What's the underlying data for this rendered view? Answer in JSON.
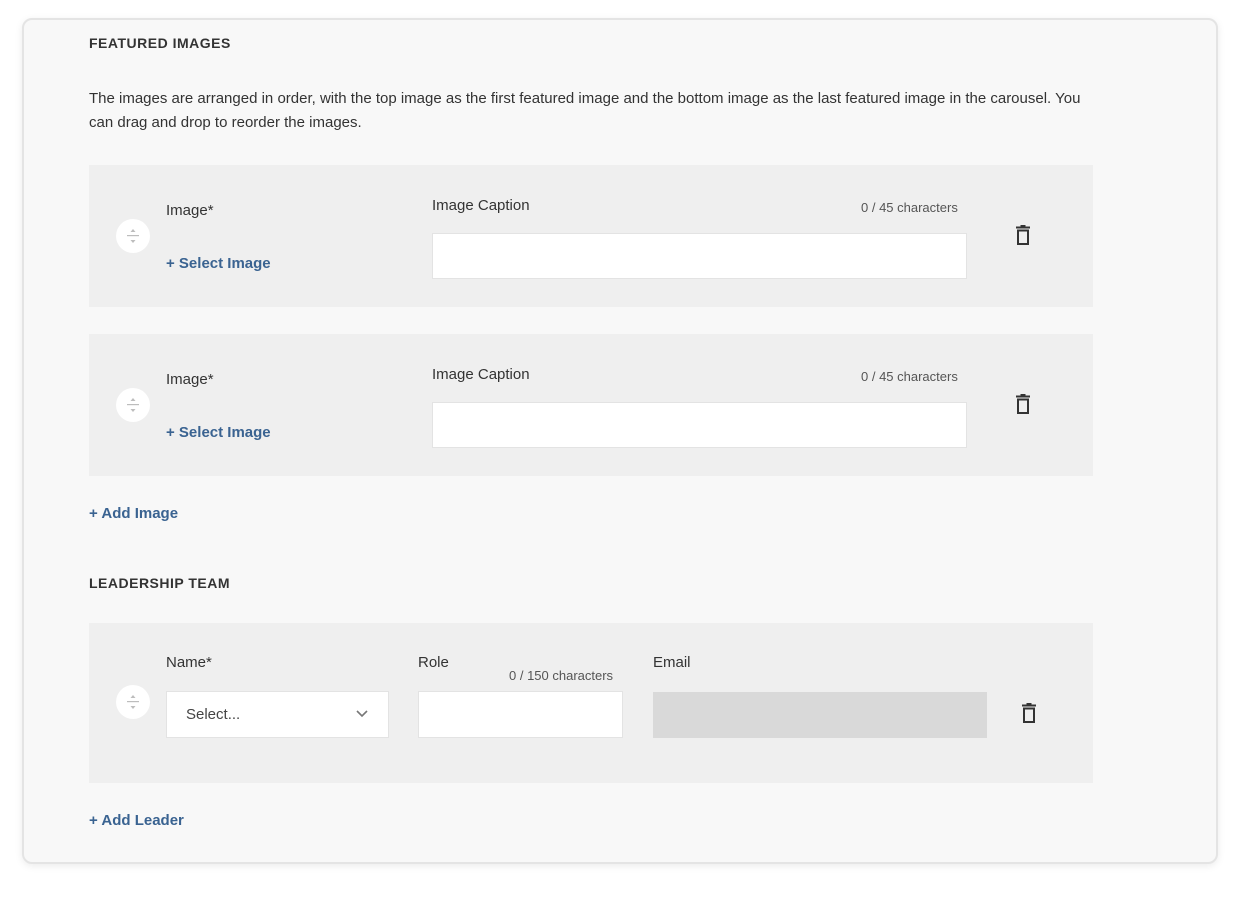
{
  "featured": {
    "title": "FEATURED IMAGES",
    "description": "The images are arranged in order, with the top image as the first featured image and the bottom image as the last featured image in the carousel. You can drag and drop to reorder the images.",
    "rows": [
      {
        "image_label": "Image*",
        "select_label": "+ Select Image",
        "caption_label": "Image Caption",
        "counter": "0 / 45 characters",
        "caption_value": "",
        "drag_icon": "drag-handle-icon",
        "delete_icon": "trash-icon"
      },
      {
        "image_label": "Image*",
        "select_label": "+ Select Image",
        "caption_label": "Image Caption",
        "counter": "0 / 45 characters",
        "caption_value": "",
        "drag_icon": "drag-handle-icon",
        "delete_icon": "trash-icon"
      }
    ],
    "add_label": "+ Add Image"
  },
  "leadership": {
    "title": "LEADERSHIP TEAM",
    "rows": [
      {
        "name_label": "Name*",
        "name_value": "Select...",
        "role_label": "Role",
        "role_counter": "0 / 150 characters",
        "role_value": "",
        "email_label": "Email",
        "email_value": "",
        "drag_icon": "drag-handle-icon",
        "delete_icon": "trash-icon",
        "dropdown_icon": "chevron-down-icon"
      }
    ],
    "add_label": "+ Add Leader"
  },
  "colors": {
    "link": "#3a6391",
    "row_bg": "#efefef",
    "card_bg": "#f8f8f8",
    "disabled_input": "#d9d9d9"
  }
}
